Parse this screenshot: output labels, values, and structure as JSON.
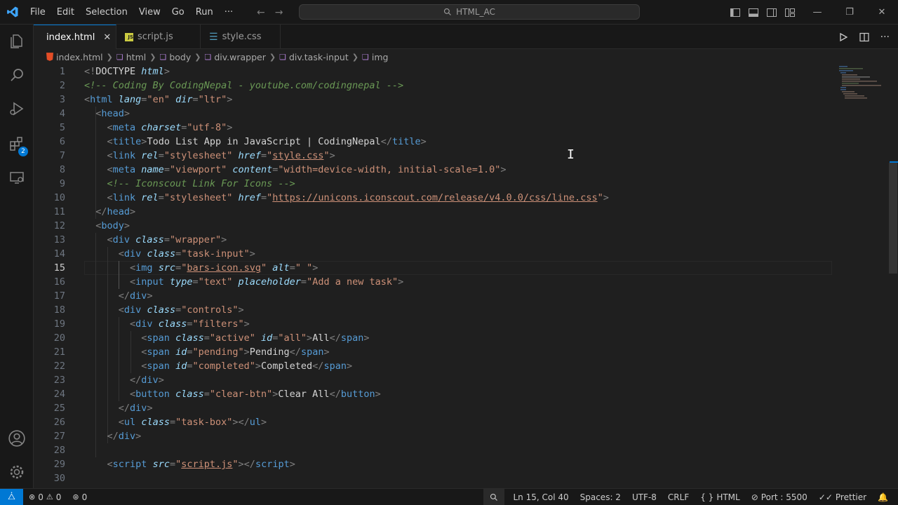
{
  "titlebar": {
    "menu": [
      "File",
      "Edit",
      "Selection",
      "View",
      "Go",
      "Run",
      "···"
    ],
    "search": "HTML_AC"
  },
  "activity": {
    "extensions_badge": "2"
  },
  "tabs": [
    {
      "label": "index.html",
      "icon": "html5-icon",
      "active": true
    },
    {
      "label": "script.js",
      "icon": "js-icon",
      "active": false
    },
    {
      "label": "style.css",
      "icon": "css-icon",
      "active": false
    }
  ],
  "breadcrumb": [
    "index.html",
    "html",
    "body",
    "div.wrapper",
    "div.task-input",
    "img"
  ],
  "editor": {
    "current_line": "15",
    "lines": [
      {
        "n": "1",
        "tokens": [
          [
            "t",
            "<!"
          ],
          [
            "tx",
            "DOCTYPE "
          ],
          [
            "at",
            "html"
          ],
          [
            "t",
            ">"
          ]
        ]
      },
      {
        "n": "2",
        "tokens": [
          [
            "c",
            "<!-- Coding By CodingNepal - youtube.com/codingnepal -->"
          ]
        ]
      },
      {
        "n": "3",
        "tokens": [
          [
            "t",
            "<"
          ],
          [
            "tn",
            "html "
          ],
          [
            "at",
            "lang"
          ],
          [
            "t",
            "="
          ],
          [
            "s",
            "\"en\" "
          ],
          [
            "at",
            "dir"
          ],
          [
            "t",
            "="
          ],
          [
            "s",
            "\"ltr\""
          ],
          [
            "t",
            ">"
          ]
        ]
      },
      {
        "n": "4",
        "tokens": [
          [
            "tx",
            "  "
          ],
          [
            "t",
            "<"
          ],
          [
            "tn",
            "head"
          ],
          [
            "t",
            ">"
          ]
        ]
      },
      {
        "n": "5",
        "tokens": [
          [
            "tx",
            "    "
          ],
          [
            "t",
            "<"
          ],
          [
            "tn",
            "meta "
          ],
          [
            "at",
            "charset"
          ],
          [
            "t",
            "="
          ],
          [
            "s",
            "\"utf-8\""
          ],
          [
            "t",
            ">"
          ]
        ]
      },
      {
        "n": "6",
        "tokens": [
          [
            "tx",
            "    "
          ],
          [
            "t",
            "<"
          ],
          [
            "tn",
            "title"
          ],
          [
            "t",
            ">"
          ],
          [
            "tx",
            "Todo List App in JavaScript | CodingNepal"
          ],
          [
            "t",
            "</"
          ],
          [
            "tn",
            "title"
          ],
          [
            "t",
            ">"
          ]
        ]
      },
      {
        "n": "7",
        "tokens": [
          [
            "tx",
            "    "
          ],
          [
            "t",
            "<"
          ],
          [
            "tn",
            "link "
          ],
          [
            "at",
            "rel"
          ],
          [
            "t",
            "="
          ],
          [
            "s",
            "\"stylesheet\" "
          ],
          [
            "at",
            "href"
          ],
          [
            "t",
            "="
          ],
          [
            "s",
            "\""
          ],
          [
            "su",
            "style.css"
          ],
          [
            "s",
            "\""
          ],
          [
            "t",
            ">"
          ]
        ]
      },
      {
        "n": "8",
        "tokens": [
          [
            "tx",
            "    "
          ],
          [
            "t",
            "<"
          ],
          [
            "tn",
            "meta "
          ],
          [
            "at",
            "name"
          ],
          [
            "t",
            "="
          ],
          [
            "s",
            "\"viewport\" "
          ],
          [
            "at",
            "content"
          ],
          [
            "t",
            "="
          ],
          [
            "s",
            "\"width=device-width, initial-scale=1.0\""
          ],
          [
            "t",
            ">"
          ]
        ]
      },
      {
        "n": "9",
        "tokens": [
          [
            "tx",
            "    "
          ],
          [
            "c",
            "<!-- Iconscout Link For Icons -->"
          ]
        ]
      },
      {
        "n": "10",
        "tokens": [
          [
            "tx",
            "    "
          ],
          [
            "t",
            "<"
          ],
          [
            "tn",
            "link "
          ],
          [
            "at",
            "rel"
          ],
          [
            "t",
            "="
          ],
          [
            "s",
            "\"stylesheet\" "
          ],
          [
            "at",
            "href"
          ],
          [
            "t",
            "="
          ],
          [
            "s",
            "\""
          ],
          [
            "su",
            "https://unicons.iconscout.com/release/v4.0.0/css/line.css"
          ],
          [
            "s",
            "\""
          ],
          [
            "t",
            ">"
          ]
        ]
      },
      {
        "n": "11",
        "tokens": [
          [
            "tx",
            "  "
          ],
          [
            "t",
            "</"
          ],
          [
            "tn",
            "head"
          ],
          [
            "t",
            ">"
          ]
        ]
      },
      {
        "n": "12",
        "tokens": [
          [
            "tx",
            "  "
          ],
          [
            "t",
            "<"
          ],
          [
            "tn",
            "body"
          ],
          [
            "t",
            ">"
          ]
        ]
      },
      {
        "n": "13",
        "tokens": [
          [
            "tx",
            "    "
          ],
          [
            "t",
            "<"
          ],
          [
            "tn",
            "div "
          ],
          [
            "at",
            "class"
          ],
          [
            "t",
            "="
          ],
          [
            "s",
            "\"wrapper\""
          ],
          [
            "t",
            ">"
          ]
        ]
      },
      {
        "n": "14",
        "tokens": [
          [
            "tx",
            "      "
          ],
          [
            "t",
            "<"
          ],
          [
            "tn",
            "div "
          ],
          [
            "at",
            "class"
          ],
          [
            "t",
            "="
          ],
          [
            "s",
            "\"task-input\""
          ],
          [
            "t",
            ">"
          ]
        ]
      },
      {
        "n": "15",
        "tokens": [
          [
            "tx",
            "        "
          ],
          [
            "t",
            "<"
          ],
          [
            "tn",
            "img "
          ],
          [
            "at",
            "src"
          ],
          [
            "t",
            "="
          ],
          [
            "s",
            "\""
          ],
          [
            "su",
            "bars-icon.svg"
          ],
          [
            "s",
            "\" "
          ],
          [
            "at",
            "alt"
          ],
          [
            "t",
            "="
          ],
          [
            "s",
            "\" \""
          ],
          [
            "t",
            ">"
          ]
        ]
      },
      {
        "n": "16",
        "tokens": [
          [
            "tx",
            "        "
          ],
          [
            "t",
            "<"
          ],
          [
            "tn",
            "input "
          ],
          [
            "at",
            "type"
          ],
          [
            "t",
            "="
          ],
          [
            "s",
            "\"text\" "
          ],
          [
            "at",
            "placeholder"
          ],
          [
            "t",
            "="
          ],
          [
            "s",
            "\"Add a new task\""
          ],
          [
            "t",
            ">"
          ]
        ]
      },
      {
        "n": "17",
        "tokens": [
          [
            "tx",
            "      "
          ],
          [
            "t",
            "</"
          ],
          [
            "tn",
            "div"
          ],
          [
            "t",
            ">"
          ]
        ]
      },
      {
        "n": "18",
        "tokens": [
          [
            "tx",
            "      "
          ],
          [
            "t",
            "<"
          ],
          [
            "tn",
            "div "
          ],
          [
            "at",
            "class"
          ],
          [
            "t",
            "="
          ],
          [
            "s",
            "\"controls\""
          ],
          [
            "t",
            ">"
          ]
        ]
      },
      {
        "n": "19",
        "tokens": [
          [
            "tx",
            "        "
          ],
          [
            "t",
            "<"
          ],
          [
            "tn",
            "div "
          ],
          [
            "at",
            "class"
          ],
          [
            "t",
            "="
          ],
          [
            "s",
            "\"filters\""
          ],
          [
            "t",
            ">"
          ]
        ]
      },
      {
        "n": "20",
        "tokens": [
          [
            "tx",
            "          "
          ],
          [
            "t",
            "<"
          ],
          [
            "tn",
            "span "
          ],
          [
            "at",
            "class"
          ],
          [
            "t",
            "="
          ],
          [
            "s",
            "\"active\" "
          ],
          [
            "at",
            "id"
          ],
          [
            "t",
            "="
          ],
          [
            "s",
            "\"all\""
          ],
          [
            "t",
            ">"
          ],
          [
            "tx",
            "All"
          ],
          [
            "t",
            "</"
          ],
          [
            "tn",
            "span"
          ],
          [
            "t",
            ">"
          ]
        ]
      },
      {
        "n": "21",
        "tokens": [
          [
            "tx",
            "          "
          ],
          [
            "t",
            "<"
          ],
          [
            "tn",
            "span "
          ],
          [
            "at",
            "id"
          ],
          [
            "t",
            "="
          ],
          [
            "s",
            "\"pending\""
          ],
          [
            "t",
            ">"
          ],
          [
            "tx",
            "Pending"
          ],
          [
            "t",
            "</"
          ],
          [
            "tn",
            "span"
          ],
          [
            "t",
            ">"
          ]
        ]
      },
      {
        "n": "22",
        "tokens": [
          [
            "tx",
            "          "
          ],
          [
            "t",
            "<"
          ],
          [
            "tn",
            "span "
          ],
          [
            "at",
            "id"
          ],
          [
            "t",
            "="
          ],
          [
            "s",
            "\"completed\""
          ],
          [
            "t",
            ">"
          ],
          [
            "tx",
            "Completed"
          ],
          [
            "t",
            "</"
          ],
          [
            "tn",
            "span"
          ],
          [
            "t",
            ">"
          ]
        ]
      },
      {
        "n": "23",
        "tokens": [
          [
            "tx",
            "        "
          ],
          [
            "t",
            "</"
          ],
          [
            "tn",
            "div"
          ],
          [
            "t",
            ">"
          ]
        ]
      },
      {
        "n": "24",
        "tokens": [
          [
            "tx",
            "        "
          ],
          [
            "t",
            "<"
          ],
          [
            "tn",
            "button "
          ],
          [
            "at",
            "class"
          ],
          [
            "t",
            "="
          ],
          [
            "s",
            "\"clear-btn\""
          ],
          [
            "t",
            ">"
          ],
          [
            "tx",
            "Clear All"
          ],
          [
            "t",
            "</"
          ],
          [
            "tn",
            "button"
          ],
          [
            "t",
            ">"
          ]
        ]
      },
      {
        "n": "25",
        "tokens": [
          [
            "tx",
            "      "
          ],
          [
            "t",
            "</"
          ],
          [
            "tn",
            "div"
          ],
          [
            "t",
            ">"
          ]
        ]
      },
      {
        "n": "26",
        "tokens": [
          [
            "tx",
            "      "
          ],
          [
            "t",
            "<"
          ],
          [
            "tn",
            "ul "
          ],
          [
            "at",
            "class"
          ],
          [
            "t",
            "="
          ],
          [
            "s",
            "\"task-box\""
          ],
          [
            "t",
            ">"
          ],
          [
            "t",
            "</"
          ],
          [
            "tn",
            "ul"
          ],
          [
            "t",
            ">"
          ]
        ]
      },
      {
        "n": "27",
        "tokens": [
          [
            "tx",
            "    "
          ],
          [
            "t",
            "</"
          ],
          [
            "tn",
            "div"
          ],
          [
            "t",
            ">"
          ]
        ]
      },
      {
        "n": "28",
        "tokens": []
      },
      {
        "n": "29",
        "tokens": [
          [
            "tx",
            "    "
          ],
          [
            "t",
            "<"
          ],
          [
            "tn",
            "script "
          ],
          [
            "at",
            "src"
          ],
          [
            "t",
            "="
          ],
          [
            "s",
            "\""
          ],
          [
            "su",
            "script.js"
          ],
          [
            "s",
            "\""
          ],
          [
            "t",
            ">"
          ],
          [
            "t",
            "</"
          ],
          [
            "tn",
            "script"
          ],
          [
            "t",
            ">"
          ]
        ]
      },
      {
        "n": "30",
        "tokens": []
      }
    ]
  },
  "statusbar": {
    "errors": "0",
    "warnings": "0",
    "ports": "0",
    "position": "Ln 15, Col 40",
    "spaces": "Spaces: 2",
    "encoding": "UTF-8",
    "eol": "CRLF",
    "language": "HTML",
    "port": "Port : 5500",
    "formatter": "Prettier"
  },
  "colors": {
    "accent": "#0078d4",
    "tag": "#569cd6",
    "attribute": "#9cdcfe",
    "string": "#ce9178",
    "comment": "#6a9955"
  }
}
